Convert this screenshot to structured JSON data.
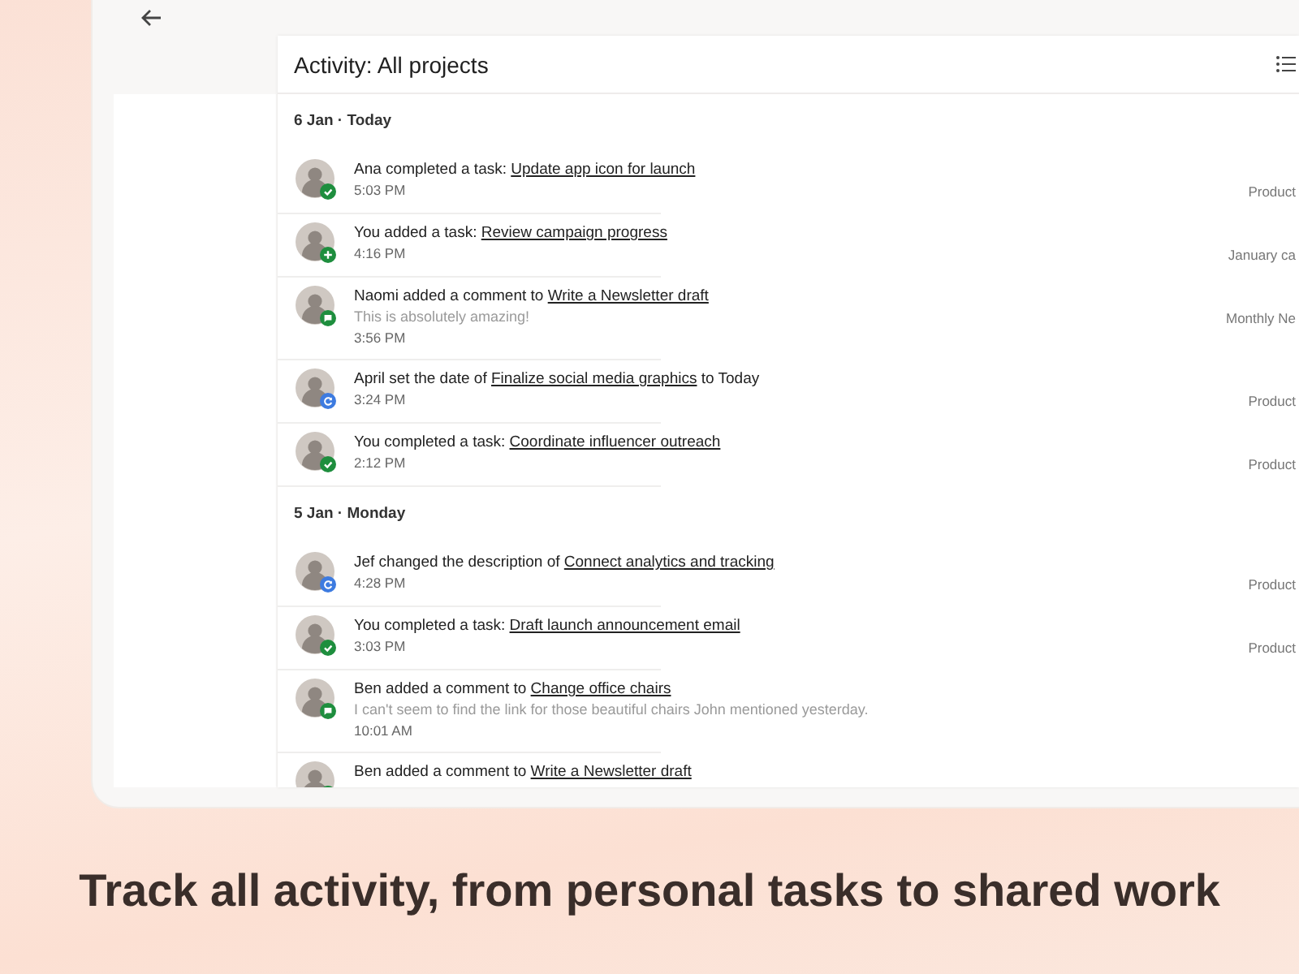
{
  "activity_panel": {
    "title": "Activity: All projects",
    "groups": [
      {
        "date": "6 Jan · Today",
        "items": [
          {
            "kind": "completed",
            "before": "Ana completed a task: ",
            "link": "Update app icon for launch",
            "time": "5:03 PM",
            "project": "Product"
          },
          {
            "kind": "added",
            "before": "You added a task: ",
            "link": "Review campaign progress",
            "time": "4:16 PM",
            "project": "January ca"
          },
          {
            "kind": "comment",
            "before": "Naomi added a comment to ",
            "link": "Write a Newsletter draft",
            "comment": "This is absolutely amazing!",
            "time": "3:56 PM",
            "project": "Monthly Ne"
          },
          {
            "kind": "edited",
            "before": "April set the date of ",
            "link": "Finalize social media graphics",
            "after": " to Today",
            "time": "3:24 PM",
            "project": "Product"
          },
          {
            "kind": "completed",
            "before": "You completed a task: ",
            "link": "Coordinate influencer outreach",
            "time": "2:12 PM",
            "project": "Product"
          }
        ]
      },
      {
        "date": "5 Jan · Monday",
        "items": [
          {
            "kind": "edited",
            "before": "Jef changed the description of ",
            "link": "Connect analytics and tracking",
            "time": "4:28 PM",
            "project": "Product"
          },
          {
            "kind": "completed",
            "before": "You completed a task: ",
            "link": "Draft launch announcement email",
            "time": "3:03 PM",
            "project": "Product"
          },
          {
            "kind": "comment",
            "before": "Ben added a comment to ",
            "link": "Change office chairs",
            "comment": "I can't seem to find the link for those beautiful chairs John mentioned yesterday.",
            "time": "10:01 AM"
          },
          {
            "kind": "comment",
            "before": "Ben added a comment to ",
            "link": "Write a Newsletter draft"
          }
        ]
      }
    ]
  },
  "headline": "Track all activity, from personal tasks to shared work"
}
